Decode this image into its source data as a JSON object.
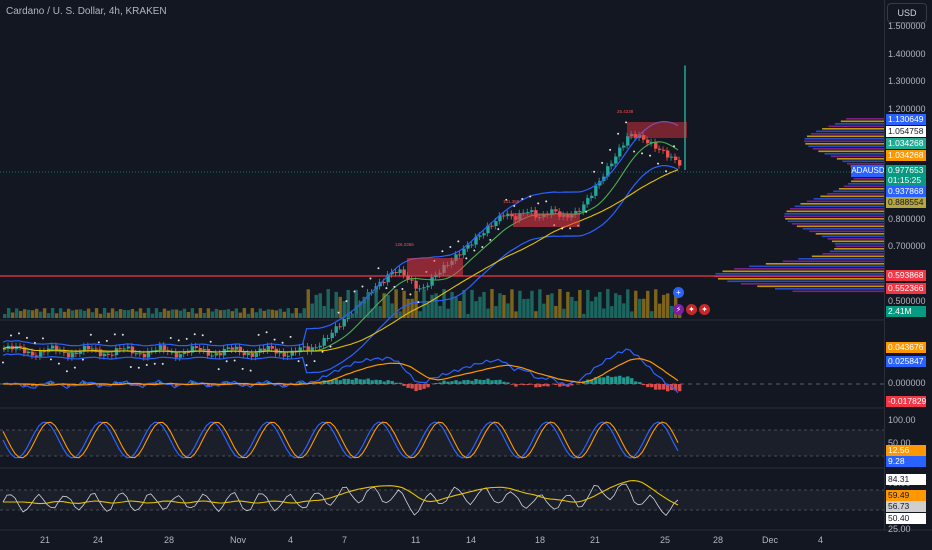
{
  "header": {
    "title": "Cardano / U. S. Dollar, 4h, KRAKEN",
    "currency": "USD"
  },
  "price_axis": {
    "ticks": [
      "1.500000",
      "1.400000",
      "1.300000",
      "1.200000",
      "0.900000",
      "0.800000",
      "0.700000",
      "0.600000",
      "0.500000"
    ]
  },
  "price_badges": [
    {
      "text": "1.130649",
      "color": "#2962ff"
    },
    {
      "text": "1.054758",
      "color": "#ffffff"
    },
    {
      "text": "1.034268",
      "color": "#22ab94"
    },
    {
      "text": "1.034268",
      "color": "#ff9800"
    },
    {
      "text": "0.977653",
      "color": "#089981"
    },
    {
      "text": "01:15:25",
      "color": "#089981"
    },
    {
      "text": "0.937868",
      "color": "#2962ff"
    },
    {
      "text": "0.888554",
      "color": "#b5a642"
    },
    {
      "text": "0.593868",
      "color": "#f23645"
    },
    {
      "text": "0.552366",
      "color": "#f23645"
    },
    {
      "text": "2.41M",
      "color": "#089981"
    }
  ],
  "symbol_tag": "ADAUSD",
  "zone_labels": [
    "126.2366",
    "131.389",
    "25.4238"
  ],
  "macd": {
    "badges": [
      {
        "text": "0.043676",
        "color": "#ff9800"
      },
      {
        "text": "0.025847",
        "color": "#2962ff"
      },
      {
        "text": "-0.017829",
        "color": "#f23645"
      }
    ],
    "zero_label": "0.000000"
  },
  "stoch": {
    "label_100": "100.00",
    "label_50": "50.00",
    "badges": [
      {
        "text": "12.56",
        "color": "#ff9800"
      },
      {
        "text": "9.28",
        "color": "#2962ff"
      }
    ]
  },
  "rsi": {
    "label_75": "75.00",
    "label_25": "25.00",
    "badges": [
      {
        "text": "84.31",
        "color": "#ffffff"
      },
      {
        "text": "59.49",
        "color": "#ff9800"
      },
      {
        "text": "56.73",
        "color": "#cfcfcf"
      },
      {
        "text": "50.40",
        "color": "#ffffff"
      }
    ]
  },
  "time_axis": [
    "21",
    "24",
    "28",
    "Nov",
    "4",
    "7",
    "11",
    "14",
    "18",
    "21",
    "25",
    "28",
    "Dec",
    "4"
  ],
  "colors": {
    "up": "#26a69a",
    "down": "#ef5350",
    "bb": "#2962ff",
    "ema": "#4caf50",
    "ema2": "#ffeb3b"
  },
  "chart_data": {
    "type": "candlestick",
    "instrument": "Cardano / U. S. Dollar, 4h, KRAKEN",
    "price_levels_horizontal": [
      0.593868,
      0.552366
    ],
    "last_price": 0.977653,
    "current_volume": "2.41M",
    "approx_closes_by_date": {
      "21 Oct": 0.35,
      "Nov": 0.33,
      "7 Nov": 0.38,
      "11 Nov": 0.58,
      "14 Nov": 0.54,
      "18 Nov": 0.8,
      "21 Nov": 0.82,
      "25 Nov": 1.13,
      "26 Nov": 0.98
    },
    "indicators": [
      "Bollinger Bands",
      "EMA",
      "Parabolic SAR",
      "Volume",
      "Volume Profile",
      "MACD",
      "Stochastic RSI",
      "RSI"
    ]
  }
}
